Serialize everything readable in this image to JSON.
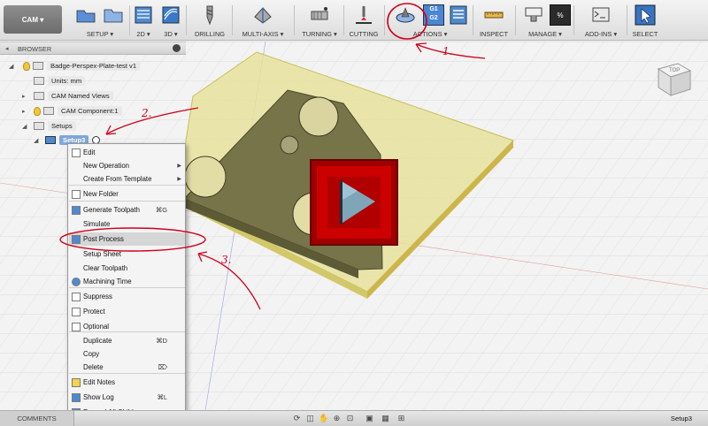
{
  "toolbar": {
    "workspace": "CAM",
    "groups": [
      {
        "label": "SETUP",
        "dropdown": true
      },
      {
        "label": "2D",
        "dropdown": true
      },
      {
        "label": "3D",
        "dropdown": true
      },
      {
        "label": "DRILLING",
        "dropdown": false
      },
      {
        "label": "MULTI-AXIS",
        "dropdown": true
      },
      {
        "label": "TURNING",
        "dropdown": true
      },
      {
        "label": "CUTTING",
        "dropdown": false
      },
      {
        "label": "ACTIONS",
        "dropdown": true
      },
      {
        "label": "INSPECT",
        "dropdown": false
      },
      {
        "label": "MANAGE",
        "dropdown": true
      },
      {
        "label": "ADD-INS",
        "dropdown": true
      },
      {
        "label": "SELECT",
        "dropdown": false
      }
    ],
    "g1g2_top": "G1",
    "g1g2_bottom": "G2"
  },
  "browser": {
    "title": "BROWSER",
    "tree": [
      {
        "label": "Badge-Perspex-Plate-test v1",
        "level": 0
      },
      {
        "label": "Units: mm",
        "level": 1
      },
      {
        "label": "CAM Named Views",
        "level": 1
      },
      {
        "label": "CAM Component:1",
        "level": 1
      },
      {
        "label": "Setups",
        "level": 1
      },
      {
        "label": "Setup3",
        "level": 2
      }
    ]
  },
  "context_menu": {
    "items": [
      {
        "label": "Edit",
        "shortcut": "",
        "submenu": false
      },
      {
        "label": "New Operation",
        "shortcut": "",
        "submenu": true
      },
      {
        "label": "Create From Template",
        "shortcut": "",
        "submenu": true
      },
      {
        "label": "New Folder",
        "shortcut": "",
        "submenu": false
      },
      {
        "label": "Generate Toolpath",
        "shortcut": "⌘G",
        "submenu": false
      },
      {
        "label": "Simulate",
        "shortcut": "",
        "submenu": false
      },
      {
        "label": "Post Process",
        "shortcut": "",
        "submenu": false,
        "highlighted": true
      },
      {
        "label": "Setup Sheet",
        "shortcut": "",
        "submenu": false
      },
      {
        "label": "Clear Toolpath",
        "shortcut": "",
        "submenu": false
      },
      {
        "label": "Machining Time",
        "shortcut": "",
        "submenu": false
      },
      {
        "label": "Suppress",
        "shortcut": "",
        "submenu": false
      },
      {
        "label": "Protect",
        "shortcut": "",
        "submenu": false
      },
      {
        "label": "Optional",
        "shortcut": "",
        "submenu": false
      },
      {
        "label": "Duplicate",
        "shortcut": "⌘D",
        "submenu": false
      },
      {
        "label": "Copy",
        "shortcut": "",
        "submenu": false
      },
      {
        "label": "Delete",
        "shortcut": "⌦",
        "submenu": false
      },
      {
        "label": "Edit Notes",
        "shortcut": "",
        "submenu": false
      },
      {
        "label": "Show Log",
        "shortcut": "⌘L",
        "submenu": false
      },
      {
        "label": "Expand All Children",
        "shortcut": "",
        "submenu": false
      }
    ]
  },
  "viewcube": {
    "face": "TOP"
  },
  "annotations": {
    "one": "1.",
    "two": "2.",
    "three": "3."
  },
  "bottombar": {
    "comments": "COMMENTS",
    "status": "Setup3"
  },
  "colors": {
    "stock": "#e6e29a",
    "part": "#77744a",
    "play": "#cc0000",
    "annotation": "#d0001a"
  }
}
